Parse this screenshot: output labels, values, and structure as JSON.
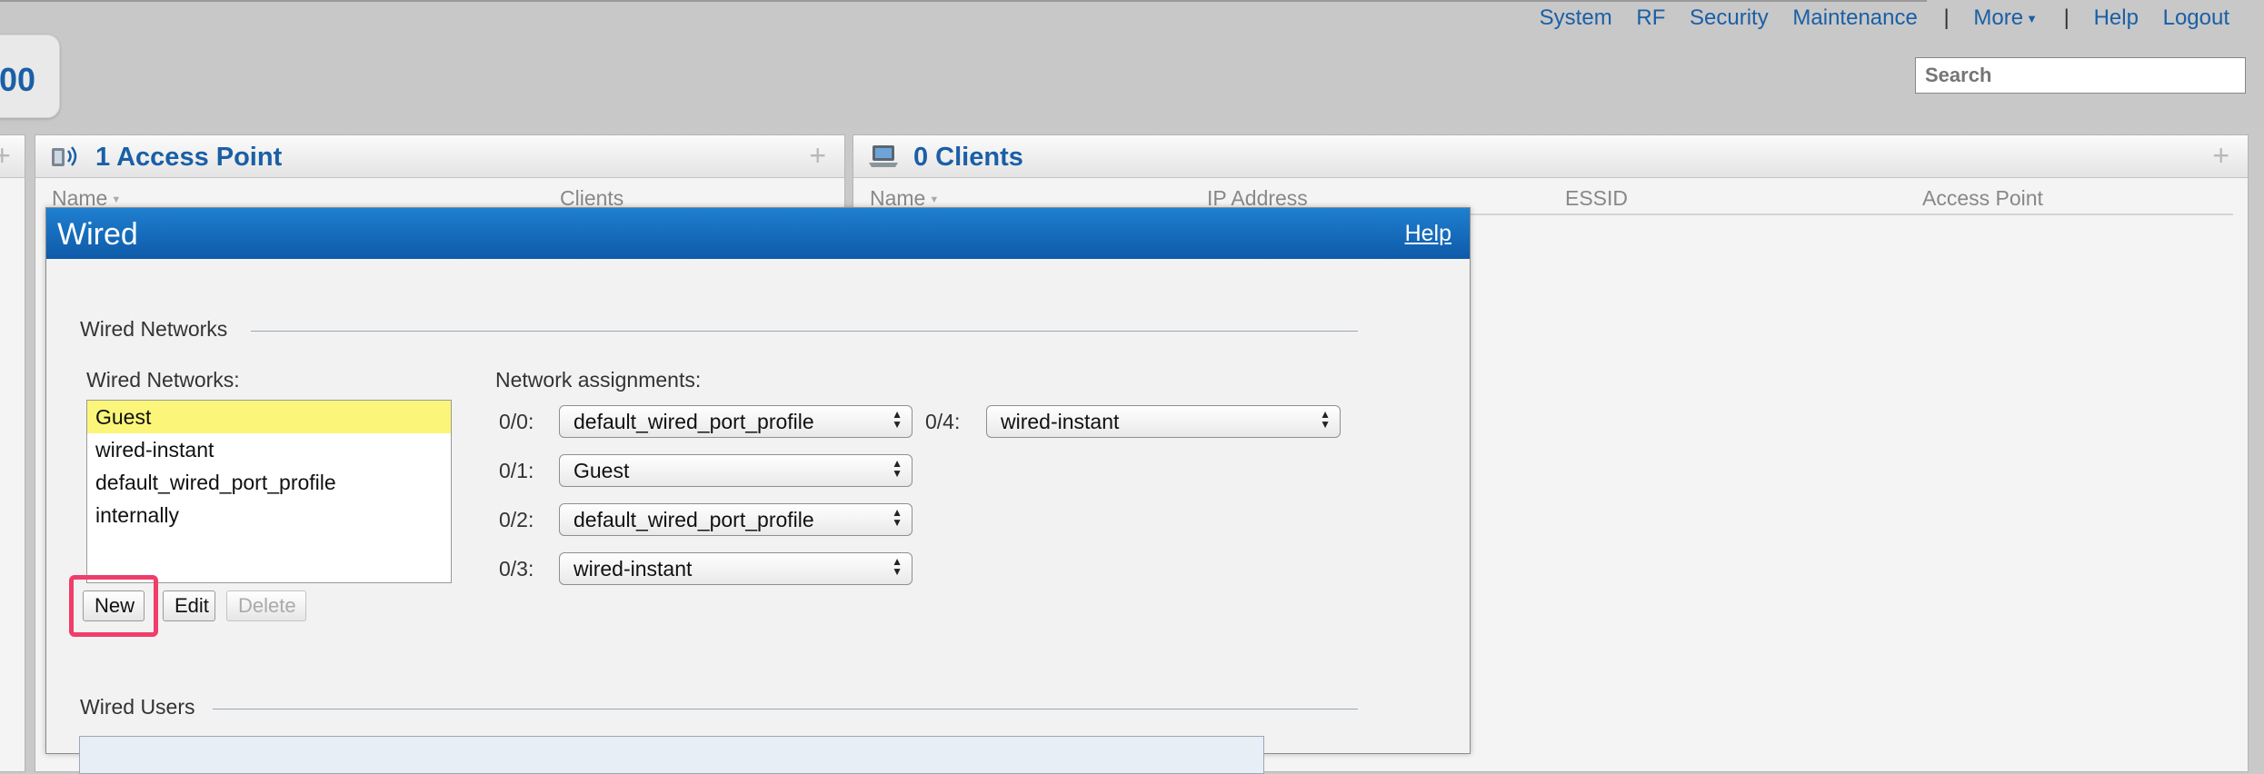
{
  "topnav": {
    "system": "System",
    "rf": "RF",
    "security": "Security",
    "maintenance": "Maintenance",
    "sep1": "|",
    "more": "More",
    "sep2": "|",
    "help": "Help",
    "logout": "Logout"
  },
  "logo_text": "00",
  "search": {
    "placeholder": "Search"
  },
  "access_points": {
    "title": "1 Access Point",
    "plus": "+",
    "columns": [
      "Name",
      "Clients"
    ]
  },
  "clients": {
    "title": "0 Clients",
    "plus": "+",
    "columns": [
      "Name",
      "IP Address",
      "ESSID",
      "Access Point"
    ]
  },
  "left_panel_plus": "+",
  "dialog": {
    "title": "Wired",
    "help": "Help",
    "wired_networks_section": "Wired Networks",
    "wired_networks_label": "Wired Networks:",
    "networks": [
      "Guest",
      "wired-instant",
      "default_wired_port_profile",
      "internally"
    ],
    "selected_network": "Guest",
    "buttons": {
      "new": "New",
      "edit": "Edit",
      "delete": "Delete"
    },
    "assignments_label": "Network assignments:",
    "ports": [
      {
        "port": "0/0:",
        "value": "default_wired_port_profile"
      },
      {
        "port": "0/1:",
        "value": "Guest"
      },
      {
        "port": "0/2:",
        "value": "default_wired_port_profile"
      },
      {
        "port": "0/3:",
        "value": "wired-instant"
      },
      {
        "port": "0/4:",
        "value": "wired-instant"
      }
    ],
    "wired_users_section": "Wired Users"
  },
  "colors": {
    "accent_blue": "#1a5fa6",
    "dialog_header": "#0e5aa8",
    "selected_row": "#fbf67a",
    "highlight": "#f03d6a"
  }
}
